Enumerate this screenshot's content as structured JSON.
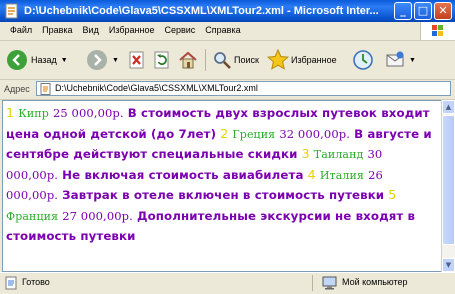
{
  "window": {
    "title": "D:\\Uchebnik\\Code\\Glava5\\CSSXML\\XMLTour2.xml - Microsoft Inter..."
  },
  "menu": [
    "Файл",
    "Правка",
    "Вид",
    "Избранное",
    "Сервис",
    "Справка"
  ],
  "toolbar": {
    "back_label": "Назад",
    "search_label": "Поиск",
    "favorites_label": "Избранное"
  },
  "address": {
    "label": "Адрес",
    "url": "D:\\Uchebnik\\Code\\Glava5\\CSSXML\\XMLTour2.xml"
  },
  "tours": [
    {
      "num": "1",
      "place": "Кипр",
      "price": "25 000,00р.",
      "desc": "В стоимость двух взрослых путевок входит цена одной детской (до 7лет)"
    },
    {
      "num": "2",
      "place": "Греция",
      "price": "32 000,00р.",
      "desc": "В августе и сентябре действуют специальные скидки"
    },
    {
      "num": "3",
      "place": "Таиланд",
      "price": "30 000,00р.",
      "desc": "Не включая стоимость авиабилета"
    },
    {
      "num": "4",
      "place": "Италия",
      "price": "26 000,00р.",
      "desc": "Завтрак в отеле включен в стоимость путевки"
    },
    {
      "num": "5",
      "place": "Франция",
      "price": "27 000,00р.",
      "desc": "Дополнительные экскурсии не входят в стоимость путевки"
    }
  ],
  "status": {
    "left": "Готово",
    "right": "Мой компьютер"
  },
  "colors": {
    "desc": "#7B00B0",
    "num": "#E8D200",
    "place": "#2AAE2A"
  }
}
